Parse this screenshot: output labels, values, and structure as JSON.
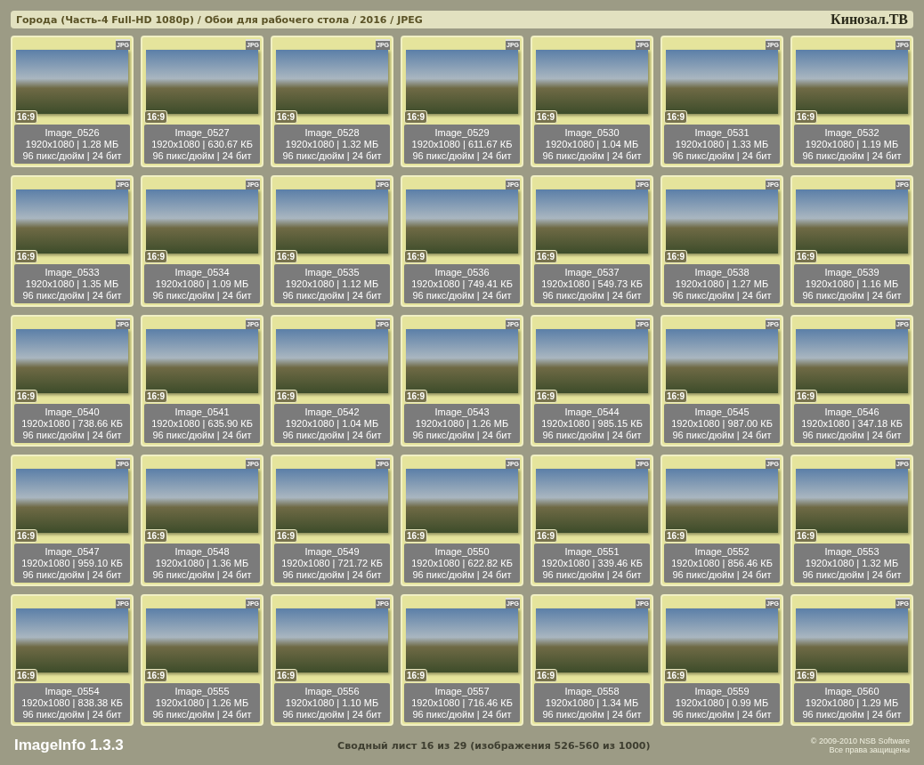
{
  "header": {
    "title": "Города (Часть-4 Full-HD 1080p) / Обои для рабочего стола / 2016 / JPEG",
    "brand": "Кинозал.ТВ"
  },
  "images": [
    {
      "format": "JPG",
      "ratio": "16:9",
      "name": "Image_0526",
      "size": "1920x1080 | 1.28 МБ",
      "info": "96 пикс/дюйм | 24 бит"
    },
    {
      "format": "JPG",
      "ratio": "16:9",
      "name": "Image_0527",
      "size": "1920x1080 | 630.67 КБ",
      "info": "96 пикс/дюйм | 24 бит"
    },
    {
      "format": "JPG",
      "ratio": "16:9",
      "name": "Image_0528",
      "size": "1920x1080 | 1.32 МБ",
      "info": "96 пикс/дюйм | 24 бит"
    },
    {
      "format": "JPG",
      "ratio": "16:9",
      "name": "Image_0529",
      "size": "1920x1080 | 611.67 КБ",
      "info": "96 пикс/дюйм | 24 бит"
    },
    {
      "format": "JPG",
      "ratio": "16:9",
      "name": "Image_0530",
      "size": "1920x1080 | 1.04 МБ",
      "info": "96 пикс/дюйм | 24 бит"
    },
    {
      "format": "JPG",
      "ratio": "16:9",
      "name": "Image_0531",
      "size": "1920x1080 | 1.33 МБ",
      "info": "96 пикс/дюйм | 24 бит"
    },
    {
      "format": "JPG",
      "ratio": "16:9",
      "name": "Image_0532",
      "size": "1920x1080 | 1.19 МБ",
      "info": "96 пикс/дюйм | 24 бит"
    },
    {
      "format": "JPG",
      "ratio": "16:9",
      "name": "Image_0533",
      "size": "1920x1080 | 1.35 МБ",
      "info": "96 пикс/дюйм | 24 бит"
    },
    {
      "format": "JPG",
      "ratio": "16:9",
      "name": "Image_0534",
      "size": "1920x1080 | 1.09 МБ",
      "info": "96 пикс/дюйм | 24 бит"
    },
    {
      "format": "JPG",
      "ratio": "16:9",
      "name": "Image_0535",
      "size": "1920x1080 | 1.12 МБ",
      "info": "96 пикс/дюйм | 24 бит"
    },
    {
      "format": "JPG",
      "ratio": "16:9",
      "name": "Image_0536",
      "size": "1920x1080 | 749.41 КБ",
      "info": "96 пикс/дюйм | 24 бит"
    },
    {
      "format": "JPG",
      "ratio": "16:9",
      "name": "Image_0537",
      "size": "1920x1080 | 549.73 КБ",
      "info": "96 пикс/дюйм | 24 бит"
    },
    {
      "format": "JPG",
      "ratio": "16:9",
      "name": "Image_0538",
      "size": "1920x1080 | 1.27 МБ",
      "info": "96 пикс/дюйм | 24 бит"
    },
    {
      "format": "JPG",
      "ratio": "16:9",
      "name": "Image_0539",
      "size": "1920x1080 | 1.16 МБ",
      "info": "96 пикс/дюйм | 24 бит"
    },
    {
      "format": "JPG",
      "ratio": "16:9",
      "name": "Image_0540",
      "size": "1920x1080 | 738.66 КБ",
      "info": "96 пикс/дюйм | 24 бит"
    },
    {
      "format": "JPG",
      "ratio": "16:9",
      "name": "Image_0541",
      "size": "1920x1080 | 635.90 КБ",
      "info": "96 пикс/дюйм | 24 бит"
    },
    {
      "format": "JPG",
      "ratio": "16:9",
      "name": "Image_0542",
      "size": "1920x1080 | 1.04 МБ",
      "info": "96 пикс/дюйм | 24 бит"
    },
    {
      "format": "JPG",
      "ratio": "16:9",
      "name": "Image_0543",
      "size": "1920x1080 | 1.26 МБ",
      "info": "96 пикс/дюйм | 24 бит"
    },
    {
      "format": "JPG",
      "ratio": "16:9",
      "name": "Image_0544",
      "size": "1920x1080 | 985.15 КБ",
      "info": "96 пикс/дюйм | 24 бит"
    },
    {
      "format": "JPG",
      "ratio": "16:9",
      "name": "Image_0545",
      "size": "1920x1080 | 987.00 КБ",
      "info": "96 пикс/дюйм | 24 бит"
    },
    {
      "format": "JPG",
      "ratio": "16:9",
      "name": "Image_0546",
      "size": "1920x1080 | 347.18 КБ",
      "info": "96 пикс/дюйм | 24 бит"
    },
    {
      "format": "JPG",
      "ratio": "16:9",
      "name": "Image_0547",
      "size": "1920x1080 | 959.10 КБ",
      "info": "96 пикс/дюйм | 24 бит"
    },
    {
      "format": "JPG",
      "ratio": "16:9",
      "name": "Image_0548",
      "size": "1920x1080 | 1.36 МБ",
      "info": "96 пикс/дюйм | 24 бит"
    },
    {
      "format": "JPG",
      "ratio": "16:9",
      "name": "Image_0549",
      "size": "1920x1080 | 721.72 КБ",
      "info": "96 пикс/дюйм | 24 бит"
    },
    {
      "format": "JPG",
      "ratio": "16:9",
      "name": "Image_0550",
      "size": "1920x1080 | 622.82 КБ",
      "info": "96 пикс/дюйм | 24 бит"
    },
    {
      "format": "JPG",
      "ratio": "16:9",
      "name": "Image_0551",
      "size": "1920x1080 | 339.46 КБ",
      "info": "96 пикс/дюйм | 24 бит"
    },
    {
      "format": "JPG",
      "ratio": "16:9",
      "name": "Image_0552",
      "size": "1920x1080 | 856.46 КБ",
      "info": "96 пикс/дюйм | 24 бит"
    },
    {
      "format": "JPG",
      "ratio": "16:9",
      "name": "Image_0553",
      "size": "1920x1080 | 1.32 МБ",
      "info": "96 пикс/дюйм | 24 бит"
    },
    {
      "format": "JPG",
      "ratio": "16:9",
      "name": "Image_0554",
      "size": "1920x1080 | 838.38 КБ",
      "info": "96 пикс/дюйм | 24 бит"
    },
    {
      "format": "JPG",
      "ratio": "16:9",
      "name": "Image_0555",
      "size": "1920x1080 | 1.26 МБ",
      "info": "96 пикс/дюйм | 24 бит"
    },
    {
      "format": "JPG",
      "ratio": "16:9",
      "name": "Image_0556",
      "size": "1920x1080 | 1.10 МБ",
      "info": "96 пикс/дюйм | 24 бит"
    },
    {
      "format": "JPG",
      "ratio": "16:9",
      "name": "Image_0557",
      "size": "1920x1080 | 716.46 КБ",
      "info": "96 пикс/дюйм | 24 бит"
    },
    {
      "format": "JPG",
      "ratio": "16:9",
      "name": "Image_0558",
      "size": "1920x1080 | 1.34 МБ",
      "info": "96 пикс/дюйм | 24 бит"
    },
    {
      "format": "JPG",
      "ratio": "16:9",
      "name": "Image_0559",
      "size": "1920x1080 | 0.99 МБ",
      "info": "96 пикс/дюйм | 24 бит"
    },
    {
      "format": "JPG",
      "ratio": "16:9",
      "name": "Image_0560",
      "size": "1920x1080 | 1.29 МБ",
      "info": "96 пикс/дюйм | 24 бит"
    }
  ],
  "footer": {
    "app": "ImageInfo 1.3.3",
    "summary": "Сводный лист 16 из 29 (изображения 526-560 из 1000)",
    "copyright": "© 2009-2010 NSB Software",
    "rights": "Все права защищены"
  }
}
